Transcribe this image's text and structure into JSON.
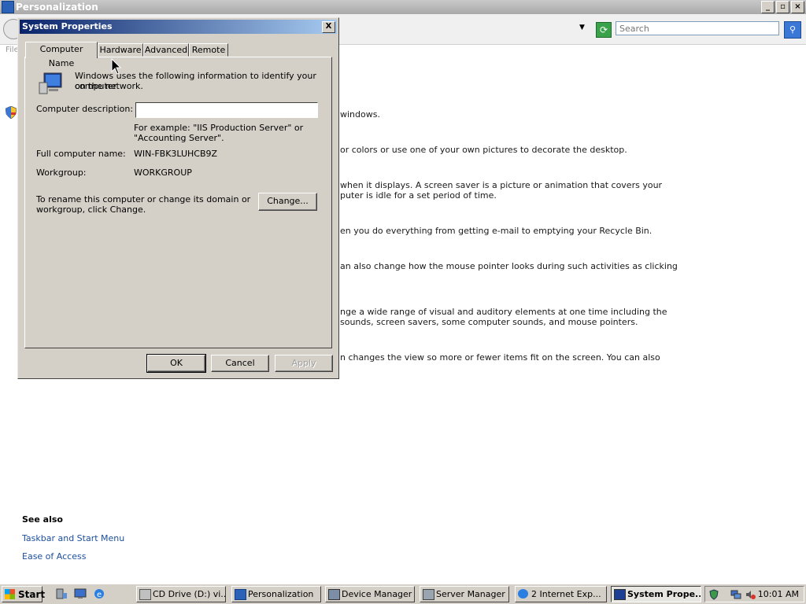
{
  "background_window": {
    "title": "Personalization",
    "search_placeholder": "Search",
    "menu_file": "File",
    "content_lines": [
      "windows.",
      "or colors or use one of your own pictures to decorate the desktop.",
      "when it displays. A screen saver is a picture or animation that covers your",
      "puter is idle for a set period of time.",
      "en you do everything from getting e-mail to emptying your Recycle Bin.",
      "an also change how the mouse pointer looks during such activities as clicking",
      "nge a wide range of visual and auditory elements at one time including the",
      "sounds, screen savers, some computer sounds, and mouse pointers.",
      "n changes the view so more or fewer items fit on the screen. You can also"
    ],
    "see_also": {
      "heading": "See also",
      "links": [
        "Taskbar and Start Menu",
        "Ease of Access"
      ]
    }
  },
  "dialog": {
    "title": "System Properties",
    "close": "X",
    "tabs": [
      "Computer Name",
      "Hardware",
      "Advanced",
      "Remote"
    ],
    "active_tab": "Computer Name",
    "intro_line1": "Windows uses the following information to identify your computer",
    "intro_line2": "on the network.",
    "description_label": "Computer description:",
    "description_value": "",
    "example_line1": "For example: \"IIS Production Server\" or",
    "example_line2": "\"Accounting Server\".",
    "full_name_label": "Full computer name:",
    "full_name_value": "WIN-FBK3LUHCB9Z",
    "workgroup_label": "Workgroup:",
    "workgroup_value": "WORKGROUP",
    "rename_line1": "To rename this computer or change its domain or",
    "rename_line2": "workgroup, click Change.",
    "change_button": "Change...",
    "ok_button": "OK",
    "cancel_button": "Cancel",
    "apply_button": "Apply"
  },
  "taskbar": {
    "start_label": "Start",
    "items": [
      "CD Drive (D:) vi...",
      "Personalization",
      "Device Manager",
      "Server Manager",
      "2 Internet Exp...",
      "System Prope..."
    ],
    "active_item": "System Prope...",
    "clock": "10:01 AM"
  }
}
